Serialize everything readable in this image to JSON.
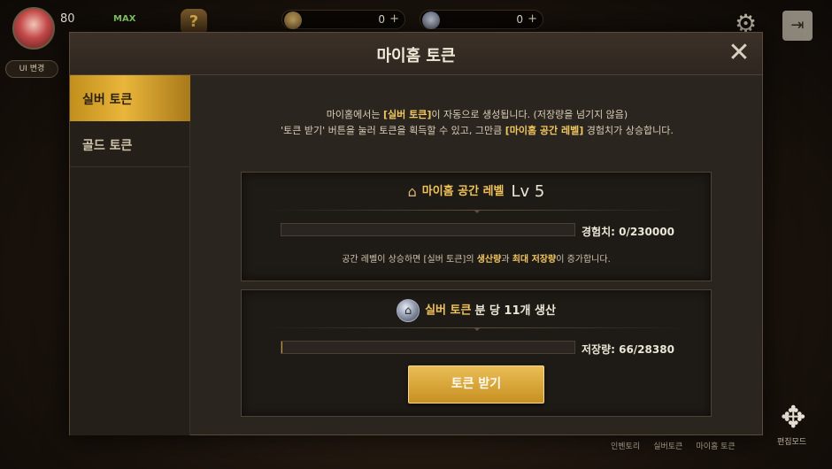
{
  "hud": {
    "level": "80",
    "max_badge": "MAX",
    "gold_amount": "0",
    "silver_amount": "0",
    "edit_badge": "UI 변경",
    "bottom_menu": [
      "인벤토리",
      "실버토큰",
      "마이홈 토큰"
    ],
    "edit_mode_label": "편집모드"
  },
  "modal": {
    "title": "마이홈 토큰",
    "close_symbol": "✕",
    "tabs": [
      {
        "label": "실버 토큰",
        "active": true
      },
      {
        "label": "골드 토큰",
        "active": false
      }
    ],
    "description": {
      "line1_a": "마이홈에서는 ",
      "line1_hl": "[실버 토큰]",
      "line1_b": "이 자동으로 생성됩니다. (저장량을 넘기지 않음)",
      "line2_a": "'토큰 받기' 버튼을 눌러 토큰을 획득할 수 있고, 그만큼 ",
      "line2_hl": "[마이홈 공간 레벨]",
      "line2_b": " 경험치가 상승합니다."
    },
    "space_level_panel": {
      "title": "마이홈 공간 레벨",
      "level": "Lv 5",
      "exp_text": "경험치: 0/230000",
      "exp_fraction": 0,
      "note_a": "공간 레벨이 상승하면 [실버 토큰]의 ",
      "note_hl1": "생산량",
      "note_mid": "과 ",
      "note_hl2": "최대 저장량",
      "note_b": "이 증가합니다."
    },
    "production_panel": {
      "token_label": "실버 토큰",
      "rate_text": "분 당 11개 생산",
      "storage_text": "저장량: 66/28380",
      "storage_fraction": 0.0023,
      "claim_button": "토큰 받기"
    }
  },
  "colors": {
    "accent_gold": "#f0c25a",
    "button_gold": "#d9a53a",
    "panel_bg": "#1e1a16"
  }
}
